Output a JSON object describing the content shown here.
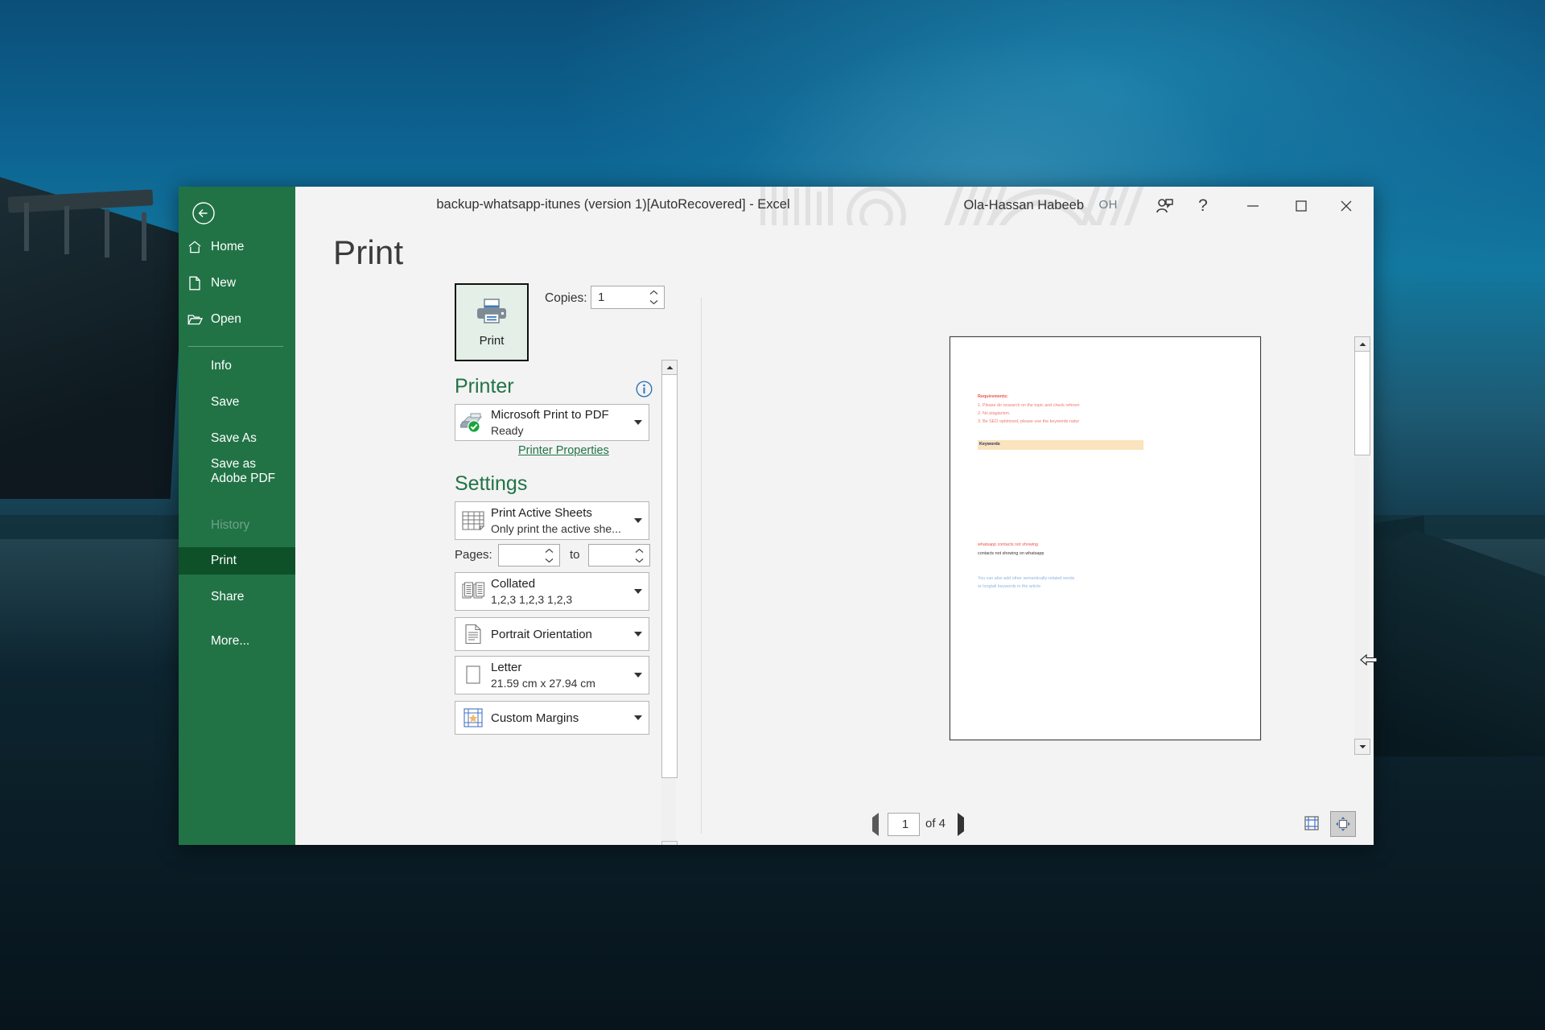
{
  "window": {
    "title": "backup-whatsapp-itunes (version 1)[AutoRecovered]  -  Excel",
    "account_name": "Ola-Hassan Habeeb",
    "avatar_initials": "OH",
    "ribbon_display_options_icon": "person-card-icon",
    "help_label": "?",
    "minimize_icon": "minimize-icon",
    "maximize_icon": "maximize-icon",
    "close_icon": "close-icon"
  },
  "nav": {
    "back_icon": "back-arrow-icon",
    "items": [
      {
        "label": "Home",
        "icon": "home-icon",
        "state": "normal"
      },
      {
        "label": "New",
        "icon": "new-document-icon",
        "state": "normal"
      },
      {
        "label": "Open",
        "icon": "open-folder-icon",
        "state": "normal"
      },
      {
        "label": "Info",
        "icon": "",
        "state": "normal"
      },
      {
        "label": "Save",
        "icon": "",
        "state": "normal"
      },
      {
        "label": "Save As",
        "icon": "",
        "state": "normal"
      },
      {
        "label": "Save as Adobe PDF",
        "icon": "",
        "state": "normal"
      },
      {
        "label": "History",
        "icon": "",
        "state": "disabled"
      },
      {
        "label": "Print",
        "icon": "",
        "state": "selected"
      },
      {
        "label": "Share",
        "icon": "",
        "state": "normal"
      },
      {
        "label": "More...",
        "icon": "",
        "state": "normal"
      }
    ]
  },
  "print": {
    "page_title": "Print",
    "print_button_label": "Print",
    "print_button_icon": "printer-icon",
    "copies_label": "Copies:",
    "copies_value": "1",
    "printer_heading": "Printer",
    "printer_info_icon": "info-icon",
    "printer_name": "Microsoft Print to PDF",
    "printer_status": "Ready",
    "printer_icon": "printer-ready-icon",
    "printer_properties_link": "Printer Properties",
    "settings_heading": "Settings",
    "settings": [
      {
        "name": "print-what",
        "icon": "worksheet-icon",
        "line1": "Print Active Sheets",
        "line2": "Only print the active she..."
      },
      {
        "name": "collation",
        "icon": "collate-icon",
        "line1": "Collated",
        "line2": "1,2,3   1,2,3   1,2,3"
      },
      {
        "name": "orientation",
        "icon": "portrait-page-icon",
        "line1": "Portrait Orientation",
        "line2": ""
      },
      {
        "name": "paper-size",
        "icon": "paper-size-icon",
        "line1": "Letter",
        "line2": "21.59 cm x 27.94 cm"
      },
      {
        "name": "margins",
        "icon": "margins-icon",
        "line1": "Custom Margins",
        "line2": ""
      }
    ],
    "pages_label": "Pages:",
    "pages_from": "",
    "pages_to_label": "to",
    "pages_to": ""
  },
  "preview": {
    "page_number": "1",
    "page_count_label": "of 4",
    "prev_page_icon": "triangle-left-icon",
    "next_page_icon": "triangle-right-icon",
    "show_margins_icon": "show-margins-icon",
    "zoom_to_page_icon": "zoom-to-page-icon",
    "document": {
      "requirements_title": "Requirements:",
      "requirement_1": "1. Please do research on the topic and check referen",
      "requirement_2": "2. No plagiarism.",
      "requirement_3": "3. Be SEO optimized, please use the keywords natur",
      "keywords_heading": "Keywords",
      "keyphrase_1": "whatsapp contacts not showing",
      "keyphrase_2": "contacts not showing on whatsapp",
      "note_line_1": "You can also add other semantically-related words",
      "note_line_2": "or longtail keywords in the article"
    }
  },
  "colors": {
    "excel_green": "#217346",
    "selected_nav": "#0e5128",
    "print_button_bg": "#e3efe7",
    "keyword_band": "#fbe3bd",
    "accent_red": "#e8544c",
    "accent_blue": "#8eb4e3"
  }
}
